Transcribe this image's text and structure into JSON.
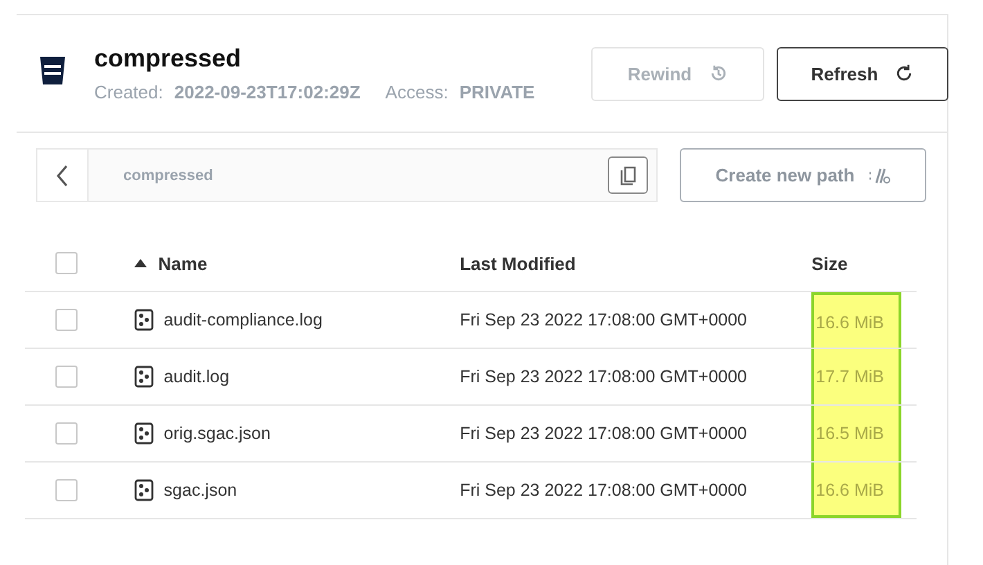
{
  "bucket": {
    "name": "compressed",
    "created_label": "Created:",
    "created": "2022-09-23T17:02:29Z",
    "access_label": "Access:",
    "access": "PRIVATE"
  },
  "actions": [
    {
      "label": "Rewind",
      "disabled": true,
      "kind": "rewind"
    },
    {
      "label": "Refresh",
      "disabled": false,
      "kind": "refresh"
    }
  ],
  "path_bar": {
    "path": "compressed"
  },
  "create_path_button": {
    "label": "Create new path",
    "disabled": true
  },
  "table": {
    "columns": [
      {
        "label": "Name",
        "sorted": true
      },
      {
        "label": "Last Modified",
        "sorted": false
      },
      {
        "label": "Size",
        "sorted": false,
        "highlighted": true
      }
    ],
    "header_checked": false,
    "rows": [
      {
        "name": "audit-compliance.log",
        "modified": "Fri Sep 23 2022 17:08:00 GMT+0000",
        "size": "16.6 MiB",
        "checked": false
      },
      {
        "name": "audit.log",
        "modified": "Fri Sep 23 2022 17:08:00 GMT+0000",
        "size": "17.7 MiB",
        "checked": false
      },
      {
        "name": "orig.sgac.json",
        "modified": "Fri Sep 23 2022 17:08:00 GMT+0000",
        "size": "16.5 MiB",
        "checked": false
      },
      {
        "name": "sgac.json",
        "modified": "Fri Sep 23 2022 17:08:00 GMT+0000",
        "size": "16.6 MiB",
        "checked": false
      }
    ]
  }
}
